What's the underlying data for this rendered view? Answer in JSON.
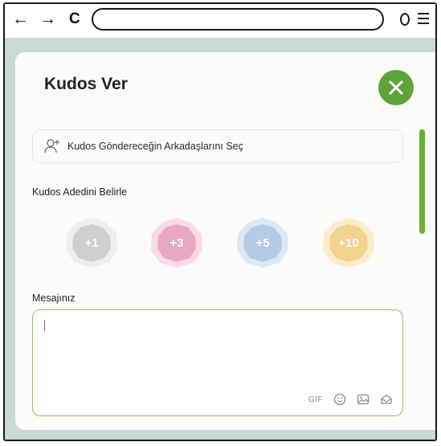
{
  "browser": {
    "back_glyph": "←",
    "forward_glyph": "→",
    "reload_glyph": "C"
  },
  "modal": {
    "title": "Kudos Ver",
    "friend_select_label": "Kudos Göndereceğin Arkadaşlarını Seç",
    "count_label": "Kudos Adedini Belirle",
    "message_label": "Mesajınız",
    "badges": [
      {
        "label": "+1",
        "color": "#cfcfcf",
        "ring": "#eeeeee"
      },
      {
        "label": "+3",
        "color": "#e8a7c2",
        "ring": "#f7dbe6"
      },
      {
        "label": "+5",
        "color": "#b3cbe6",
        "ring": "#dce8f4"
      },
      {
        "label": "+10",
        "color": "#f1d28e",
        "ring": "#fbecc8"
      }
    ],
    "message_tools": {
      "gif_label": "GIF",
      "icons": [
        "emoji-icon",
        "image-icon",
        "sticker-icon"
      ]
    }
  },
  "colors": {
    "accent": "#5ea43b",
    "backdrop": "#c9d9d5"
  }
}
